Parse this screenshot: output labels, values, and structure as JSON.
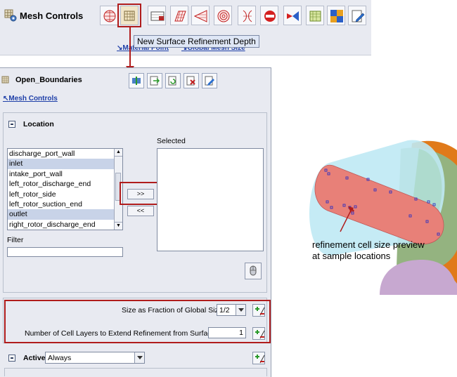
{
  "top_toolbar": {
    "title": "Mesh Controls",
    "icons": [
      "target-icon",
      "surface-refinement-icon",
      "boundary-layer-icon",
      "grid-icon",
      "cone-icon",
      "sphere-icon",
      "cylinder-section-icon",
      "stop-refinement-icon",
      "conformal-icon",
      "volume-icon",
      "block-icon",
      "edit-icon"
    ],
    "tooltip": "New Surface Refinement Depth",
    "link_material_point": "Material Point",
    "link_global_mesh_size": "Global Mesh Size"
  },
  "panel": {
    "title": "Open_Boundaries",
    "breadcrumb": "Mesh Controls",
    "location": {
      "header": "Location",
      "selected_label": "Selected",
      "available_items": [
        {
          "label": "discharge_port_wall",
          "selected": false
        },
        {
          "label": "inlet",
          "selected": true
        },
        {
          "label": "intake_port_wall",
          "selected": false
        },
        {
          "label": "left_rotor_discharge_end",
          "selected": false
        },
        {
          "label": "left_rotor_side",
          "selected": false
        },
        {
          "label": "left_rotor_suction_end",
          "selected": false
        },
        {
          "label": "outlet",
          "selected": true
        },
        {
          "label": "right_rotor_discharge_end",
          "selected": false
        }
      ],
      "add_label": ">>",
      "remove_label": "<<",
      "filter_label": "Filter",
      "filter_value": ""
    },
    "size_fraction_label": "Size as Fraction of Global Size",
    "size_fraction_value": "1/2",
    "cell_layers_label": "Number of Cell Layers to Extend Refinement from Surface",
    "cell_layers_value": "1",
    "active_label": "Active",
    "active_value": "Always"
  },
  "annotation": {
    "line1": "refinement cell size preview",
    "line2": "at sample locations"
  },
  "colors": {
    "highlight_red": "#b01c1c",
    "panel_bg": "#e8eaf1",
    "link_blue": "#1e3fa8"
  }
}
